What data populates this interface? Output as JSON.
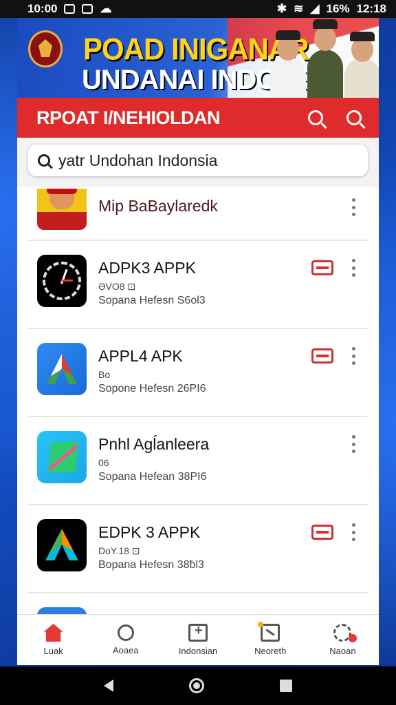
{
  "status_bar": {
    "left_time": "10:00",
    "battery": "16%",
    "clock": "12:18"
  },
  "banner": {
    "line1": "POAD INIGANAR",
    "line2": "UNDANAI INDONSIA"
  },
  "header": {
    "title": "RPOAT I/NEHIOLDAN"
  },
  "search": {
    "value": "yatr Undohan Indonsia",
    "placeholder": ""
  },
  "apps": [
    {
      "title": "Mip BaBaylaredk",
      "meta": "",
      "desc": "",
      "has_badge": false
    },
    {
      "title": "ADPK3 APPK",
      "meta": "ƏVO8 ⊡",
      "desc": "Sopana Hefesn S6ol3",
      "has_badge": true
    },
    {
      "title": "APPL4 APK",
      "meta": "Bo",
      "desc": "Sopone Hefesn 26PI6",
      "has_badge": true
    },
    {
      "title": "Pnhl Agĺanleera",
      "meta": "06",
      "desc": "Sopana Hefean 38PI6",
      "has_badge": false
    },
    {
      "title": "EDPK 3 APPK",
      "meta": "DoY.18 ⊡",
      "desc": "Bopana Hefesn 38ƀl3",
      "has_badge": true
    }
  ],
  "bottom_nav": [
    {
      "label": "Luak",
      "icon": "home-icon",
      "active": true
    },
    {
      "label": "Aoaea",
      "icon": "search-icon",
      "active": false
    },
    {
      "label": "Indonsian",
      "icon": "add-document-icon",
      "active": false
    },
    {
      "label": "Neoreth",
      "icon": "chart-icon",
      "active": false
    },
    {
      "label": "Naoan",
      "icon": "settings-icon",
      "active": false
    }
  ],
  "colors": {
    "header_red": "#df2b2b",
    "accent_red": "#e53935",
    "wallpaper_blue": "#0b3a9c"
  }
}
